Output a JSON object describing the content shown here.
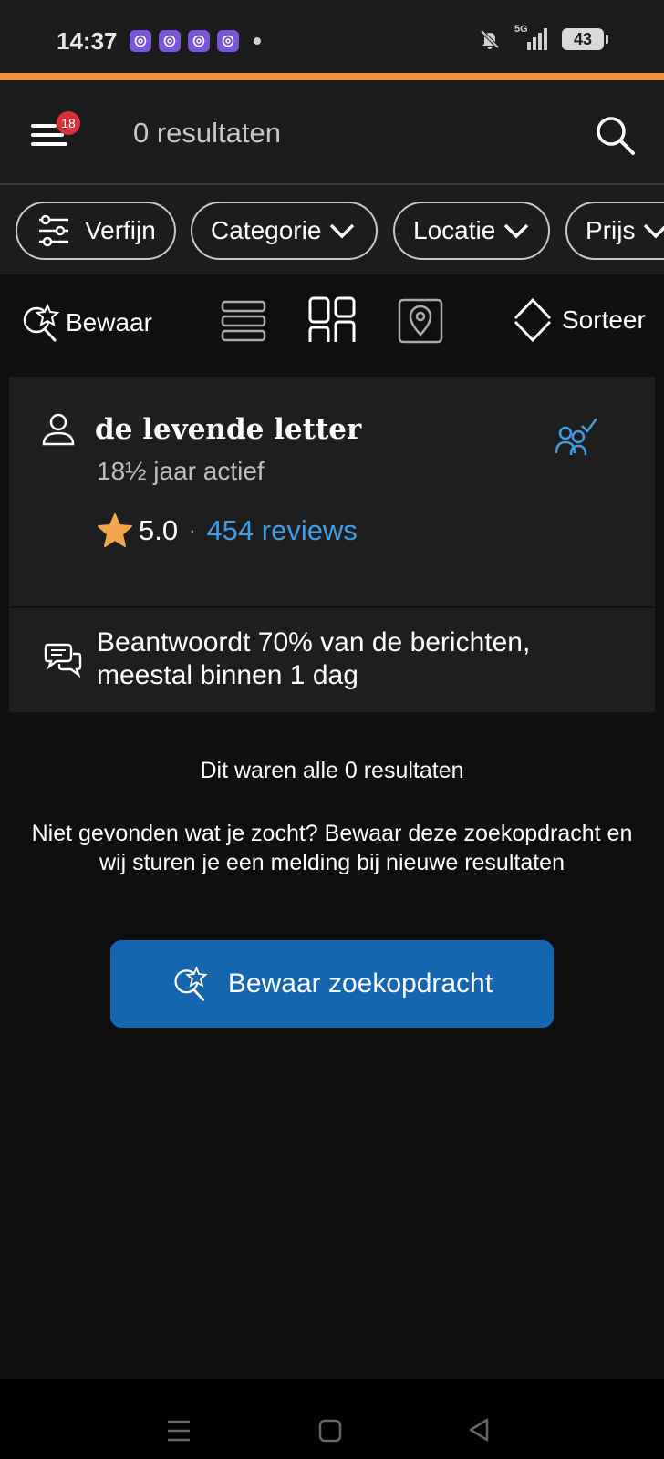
{
  "status_bar": {
    "time": "14:37",
    "battery": "43",
    "network": "5G",
    "app_icons": [
      "threads-icon",
      "threads-icon",
      "threads-icon",
      "threads-icon"
    ]
  },
  "header": {
    "notification_count": "18",
    "title": "0 resultaten"
  },
  "filters": [
    {
      "label": "Verfijn"
    },
    {
      "label": "Categorie"
    },
    {
      "label": "Locatie"
    },
    {
      "label": "Prijs"
    }
  ],
  "toolbar": {
    "save_label": "Bewaar",
    "sort_label": "Sorteer"
  },
  "seller": {
    "name": "de levende letter",
    "active": "18½ jaar actief",
    "rating": "5.0",
    "separator": "·",
    "reviews": "454 reviews",
    "reply_info": "Beantwoordt 70% van de berichten, meestal binnen 1 dag"
  },
  "results": {
    "end_message": "Dit waren alle 0 resultaten",
    "not_found_message": "Niet gevonden wat je zocht? Bewaar deze zoekopdracht en wij sturen je een melding bij nieuwe resultaten",
    "cta_label": "Bewaar zoekopdracht"
  },
  "colors": {
    "accent": "#f0903c",
    "link": "#3c9ee5",
    "button": "#1566b0",
    "badge": "#d6303b",
    "star": "#f4a64a"
  }
}
